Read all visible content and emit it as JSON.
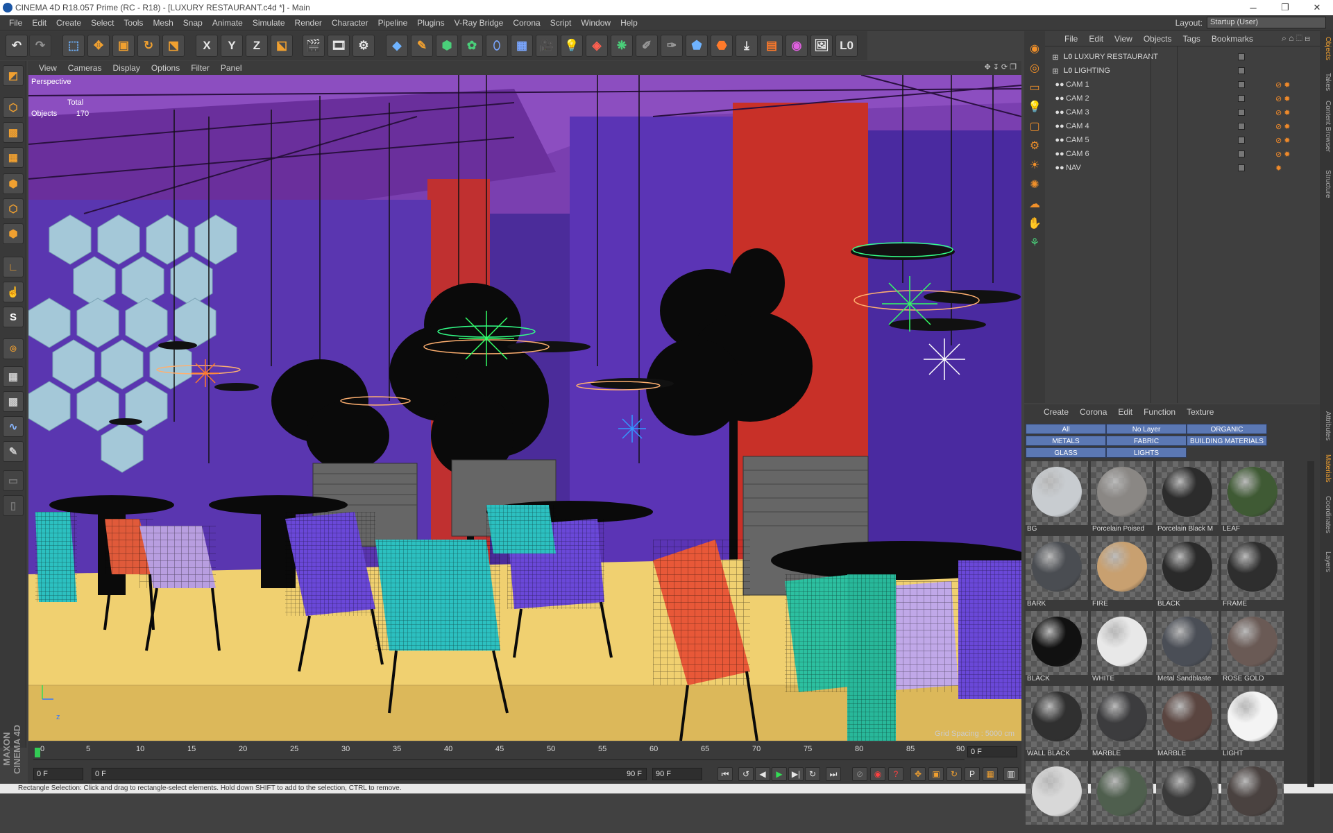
{
  "window": {
    "title": "CINEMA 4D R18.057 Prime (RC - R18) - [LUXURY RESTAURANT.c4d *] - Main",
    "controls": [
      "─",
      "❐",
      "✕"
    ]
  },
  "menu": [
    "File",
    "Edit",
    "Create",
    "Select",
    "Tools",
    "Mesh",
    "Snap",
    "Animate",
    "Simulate",
    "Render",
    "Character",
    "Pipeline",
    "Plugins",
    "V-Ray Bridge",
    "Corona",
    "Script",
    "Window",
    "Help"
  ],
  "layout": {
    "label": "Layout:",
    "value": "Startup (User)"
  },
  "toolbar": {
    "x": "X",
    "y": "Y",
    "z": "Z",
    "l": "L0"
  },
  "viewport": {
    "menu": [
      "View",
      "Cameras",
      "Display",
      "Options",
      "Filter",
      "Panel"
    ],
    "camera": "Perspective",
    "stats_header": "Total",
    "stats_label": "Objects",
    "stats_value": "170",
    "grid_spacing": "Grid Spacing : 5000 cm",
    "axis_label": "z"
  },
  "timeline": {
    "ticks": [
      "0",
      "5",
      "10",
      "15",
      "20",
      "25",
      "30",
      "35",
      "40",
      "45",
      "50",
      "55",
      "60",
      "65",
      "70",
      "75",
      "80",
      "85",
      "90"
    ],
    "current_frame": "0 F"
  },
  "transport": {
    "start": "0 F",
    "range_start": "0 F",
    "range_end": "90 F",
    "end": "90 F"
  },
  "status": "Rectangle Selection: Click and drag to rectangle-select elements. Hold down SHIFT to add to the selection, CTRL to remove.",
  "objects": {
    "menu": [
      "File",
      "Edit",
      "View",
      "Objects",
      "Tags",
      "Bookmarks"
    ],
    "items": [
      {
        "name": "LUXURY RESTAURANT",
        "icon": "L0",
        "indent": 0
      },
      {
        "name": "LIGHTING",
        "icon": "L0",
        "indent": 0
      },
      {
        "name": "CAM 1",
        "icon": "●●",
        "indent": 1
      },
      {
        "name": "CAM 2",
        "icon": "●●",
        "indent": 1
      },
      {
        "name": "CAM 3",
        "icon": "●●",
        "indent": 1
      },
      {
        "name": "CAM 4",
        "icon": "●●",
        "indent": 1
      },
      {
        "name": "CAM 5",
        "icon": "●●",
        "indent": 1
      },
      {
        "name": "CAM 6",
        "icon": "●●",
        "indent": 1
      },
      {
        "name": "NAV",
        "icon": "●●",
        "indent": 1
      }
    ]
  },
  "side_tabs": [
    "Objects",
    "Takes",
    "Content Browser",
    "Structure",
    "Attributes",
    "Materials",
    "Coordinates",
    "Layers"
  ],
  "materials": {
    "menu": [
      "Create",
      "Corona",
      "Edit",
      "Function",
      "Texture"
    ],
    "filters": [
      "All",
      "No Layer",
      "ORGANIC",
      "METALS",
      "FABRIC",
      "BUILDING MATERIALS",
      "GLASS",
      "LIGHTS"
    ],
    "items": [
      {
        "name": "BG",
        "color": "#c8ccd0"
      },
      {
        "name": "Porcelain Poised",
        "color": "#8a8784"
      },
      {
        "name": "Porcelain Black M",
        "color": "#2c2c2c"
      },
      {
        "name": "LEAF",
        "color": "#3f5a34"
      },
      {
        "name": "BARK",
        "color": "#4a4d52"
      },
      {
        "name": "FIRE",
        "color": "#c8a070"
      },
      {
        "name": "BLACK",
        "color": "#2a2a2a"
      },
      {
        "name": "FRAME",
        "color": "#2e2e2e"
      },
      {
        "name": "BLACK",
        "color": "#111111"
      },
      {
        "name": "WHITE",
        "color": "#e8e8e8"
      },
      {
        "name": "Metal Sandblaste",
        "color": "#4a4e56"
      },
      {
        "name": "ROSE GOLD",
        "color": "#6a5a55"
      },
      {
        "name": "WALL BLACK",
        "color": "#303030"
      },
      {
        "name": "MARBLE",
        "color": "#3c3c3e"
      },
      {
        "name": "MARBLE",
        "color": "#5a4540"
      },
      {
        "name": "LIGHT",
        "color": "#f4f4f4"
      },
      {
        "name": "",
        "color": "#d8d8d8"
      },
      {
        "name": "",
        "color": "#4f5f4e"
      },
      {
        "name": "",
        "color": "#3a3a3a"
      },
      {
        "name": "",
        "color": "#4a4240"
      }
    ]
  }
}
